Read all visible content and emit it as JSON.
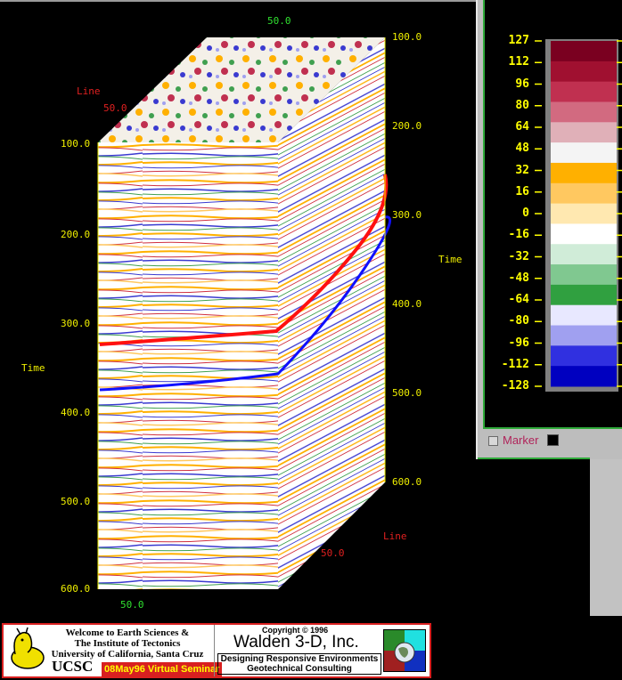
{
  "viewer": {
    "axis_ticks": {
      "left_time": [
        "100.0",
        "200.0",
        "300.0",
        "400.0",
        "500.0",
        "600.0"
      ],
      "right_time": [
        "100.0",
        "200.0",
        "300.0",
        "400.0",
        "500.0",
        "600.0"
      ],
      "line_top": "50.0",
      "line_bottom": "50.0",
      "crossline_top": "50.0",
      "crossline_bottom": "50.0"
    },
    "labels": {
      "time_left": "Time",
      "time_right": "Time",
      "line_top": "Line",
      "line_bottom": "Line"
    },
    "horizon_colors": [
      "#ff1010",
      "#1010ff"
    ]
  },
  "colorbar": {
    "ticks": [
      "127",
      "112",
      "96",
      "80",
      "64",
      "48",
      "32",
      "16",
      "0",
      "-16",
      "-32",
      "-48",
      "-64",
      "-80",
      "-96",
      "-112",
      "-128"
    ],
    "colors": [
      "#7a0020",
      "#a01030",
      "#c03050",
      "#d26a80",
      "#e0b0b8",
      "#f4f4f4",
      "#ffb000",
      "#ffc860",
      "#ffe8b0",
      "#ffffff",
      "#d0ecd8",
      "#80c890",
      "#30a040",
      "#e8e8ff",
      "#a0a0f0",
      "#3030e0",
      "#0000c0"
    ],
    "marker_label": "Marker",
    "marker_color": "#000000"
  },
  "banner": {
    "welcome_line1": "Welcome to Earth Sciences &",
    "welcome_line2": "The Institute of Tectonics",
    "welcome_line3": "University of California, Santa Cruz",
    "ucsc": "UCSC",
    "seminar": "08May96 Virtual Seminar",
    "copyright": "Copyright © 1996",
    "company": "Walden 3-D, Inc.",
    "tagline1": "Designing Responsive Environments",
    "tagline2": "Geotechnical Consulting"
  }
}
